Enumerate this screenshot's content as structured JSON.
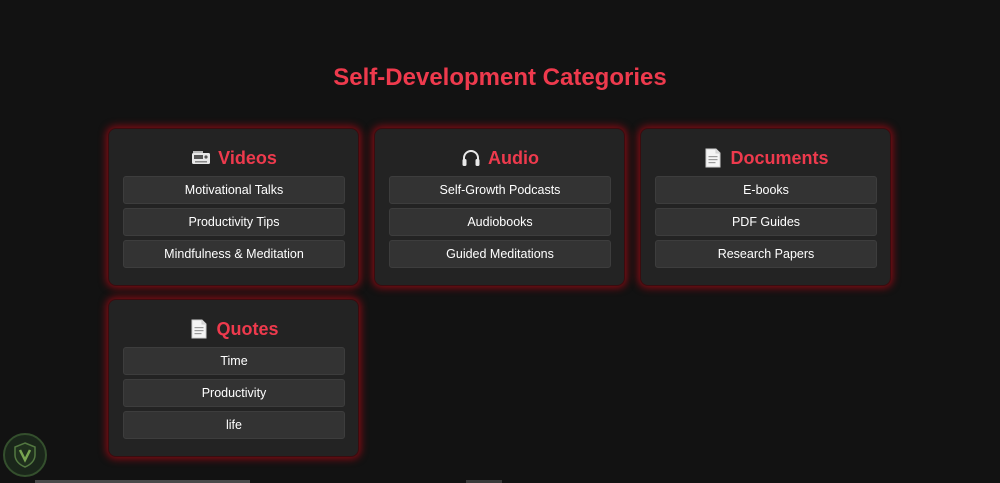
{
  "page": {
    "title": "Self-Development Categories"
  },
  "colors": {
    "background": "#121212",
    "card": "#232323",
    "accent": "#ee3a4d",
    "glow": "#aa0a14",
    "item": "#333333",
    "text": "#ffffff"
  },
  "categories": [
    {
      "icon": "video-camera-icon",
      "glyph": "📼",
      "title": "Videos",
      "items": [
        "Motivational Talks",
        "Productivity Tips",
        "Mindfulness & Meditation"
      ]
    },
    {
      "icon": "headphones-icon",
      "glyph": "🎧",
      "title": "Audio",
      "items": [
        "Self-Growth Podcasts",
        "Audiobooks",
        "Guided Meditations"
      ]
    },
    {
      "icon": "document-icon",
      "glyph": "📄",
      "title": "Documents",
      "items": [
        "E-books",
        "PDF Guides",
        "Research Papers"
      ]
    },
    {
      "icon": "document-icon",
      "glyph": "📄",
      "title": "Quotes",
      "items": [
        "Time",
        "Productivity",
        "life"
      ]
    }
  ],
  "watermark": {
    "icon": "shield-logo-icon"
  }
}
